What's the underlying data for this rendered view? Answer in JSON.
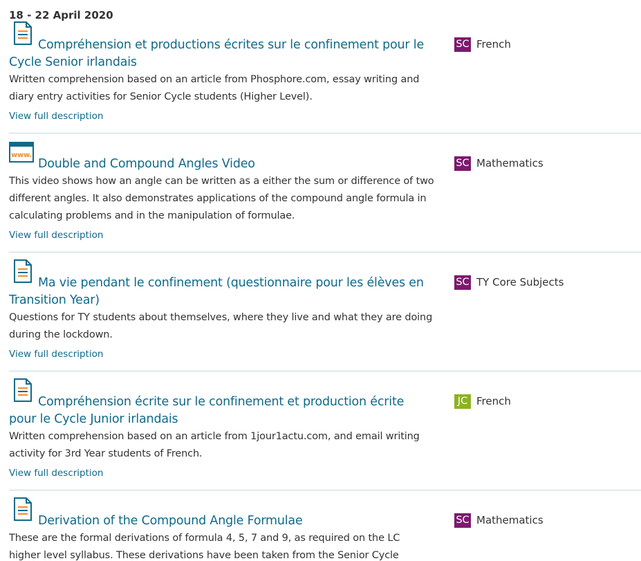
{
  "date_heading": "18 - 22 April 2020",
  "more_label": "View full description",
  "colors": {
    "link": "#106a8a",
    "senior_cycle": "#7b1a6e",
    "junior_cycle": "#8cb31f",
    "divider": "#c3d9de",
    "doc_icon_lines": "#f28c28"
  },
  "resources": [
    {
      "icon": "document-icon",
      "title": "Compréhension et productions écrites sur le confinement pour le Cycle Senior irlandais",
      "description": "Written comprehension based on an article from Phosphore.com, essay writing and diary entry activities for Senior Cycle students (Higher Level).",
      "level": "SC",
      "subject": "French"
    },
    {
      "icon": "website-icon",
      "title": "Double and Compound Angles Video",
      "description": "This video shows how an angle can be written as a either the sum or difference of two different angles. It also demonstrates applications of the compound angle formula in calculating problems and in the manipulation of formulae.",
      "level": "SC",
      "subject": "Mathematics"
    },
    {
      "icon": "document-icon",
      "title": "Ma vie pendant le confinement (questionnaire pour les élèves en Transition Year)",
      "description": "Questions for TY students about themselves, where they live and what they are doing during the lockdown.",
      "level": "SC",
      "subject": "TY Core Subjects"
    },
    {
      "icon": "document-icon",
      "title": "Compréhension écrite sur le confinement et production écrite pour le Cycle Junior irlandais",
      "description": "Written comprehension based on an article from 1jour1actu.com, and email writing activity for 3rd Year students of French.",
      "level": "JC",
      "subject": "French"
    },
    {
      "icon": "document-icon",
      "title": "Derivation of the Compound Angle Formulae",
      "description": "These are the formal derivations of formula 4, 5, 7 and 9, as required on the LC higher level syllabus. These derivations have been taken from the Senior Cycle",
      "level": "SC",
      "subject": "Mathematics"
    }
  ]
}
